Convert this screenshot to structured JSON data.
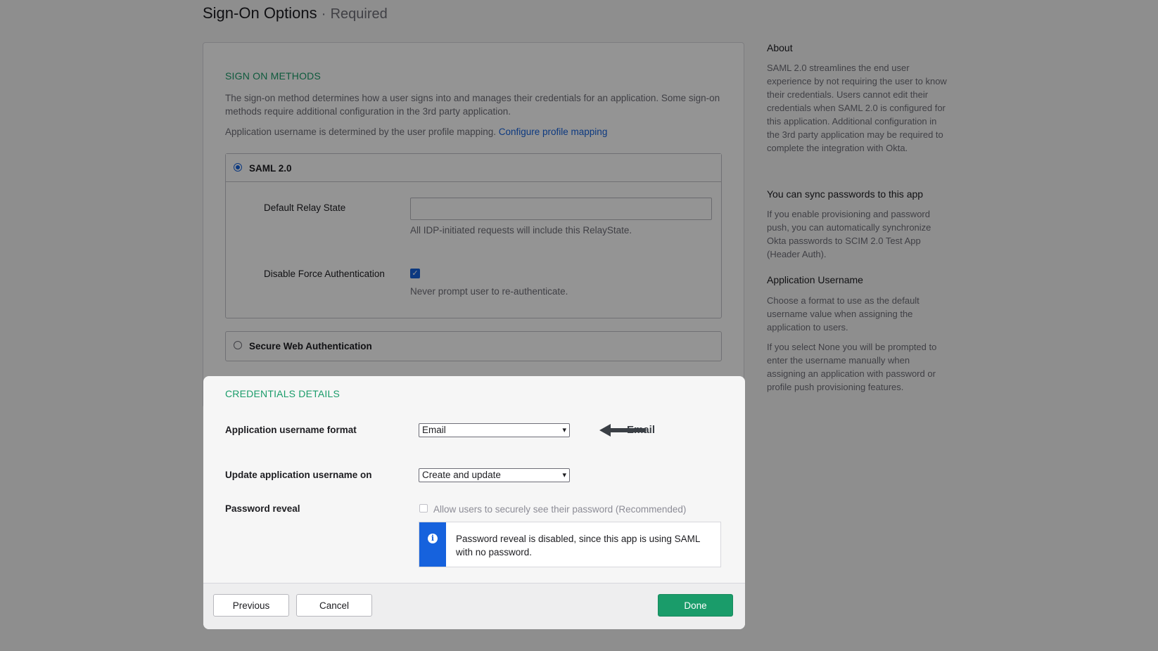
{
  "page": {
    "title": "Sign-On Options",
    "title_separator": "·",
    "required": "Required"
  },
  "sign_on": {
    "section_title": "SIGN ON METHODS",
    "description": "The sign-on method determines how a user signs into and manages their credentials for an application. Some sign-on methods require additional configuration in the 3rd party application.",
    "username_note": "Application username is determined by the user profile mapping.",
    "configure_link": "Configure profile mapping",
    "saml": {
      "label": "SAML 2.0",
      "selected": true,
      "relay_state_label": "Default Relay State",
      "relay_state_value": "",
      "relay_state_hint": "All IDP-initiated requests will include this RelayState.",
      "force_auth_label": "Disable Force Authentication",
      "force_auth_checked": true,
      "force_auth_hint": "Never prompt user to re-authenticate."
    },
    "swa": {
      "label": "Secure Web Authentication",
      "selected": false
    }
  },
  "sidebar": {
    "about_title": "About",
    "about_text": "SAML 2.0 streamlines the end user experience by not requiring the user to know their credentials. Users cannot edit their credentials when SAML 2.0 is configured for this application. Additional configuration in the 3rd party application may be required to complete the integration with Okta.",
    "sync_title": "You can sync passwords to this app",
    "sync_text": "If you enable provisioning and password push, you can automatically synchronize Okta passwords to SCIM 2.0 Test App (Header Auth).",
    "username_title": "Application Username",
    "username_text_1": "Choose a format to use as the default username value when assigning the application to users.",
    "username_text_2": "If you select None you will be prompted to enter the username manually when assigning an application with password or profile push provisioning features."
  },
  "credentials": {
    "section_title": "CREDENTIALS DETAILS",
    "username_format_label": "Application username format",
    "username_format_value": "Email",
    "annotation_text": "Email",
    "update_on_label": "Update application username on",
    "update_on_value": "Create and update",
    "password_reveal_label": "Password reveal",
    "password_reveal_checkbox": "Allow users to securely see their password (Recommended)",
    "info_message": "Password reveal is disabled, since this app is using SAML with no password."
  },
  "footer": {
    "previous": "Previous",
    "cancel": "Cancel",
    "done": "Done"
  },
  "colors": {
    "accent_green": "#1a9c6a",
    "link_blue": "#1662dd",
    "overlay": "rgba(0,0,0,0.42)"
  }
}
